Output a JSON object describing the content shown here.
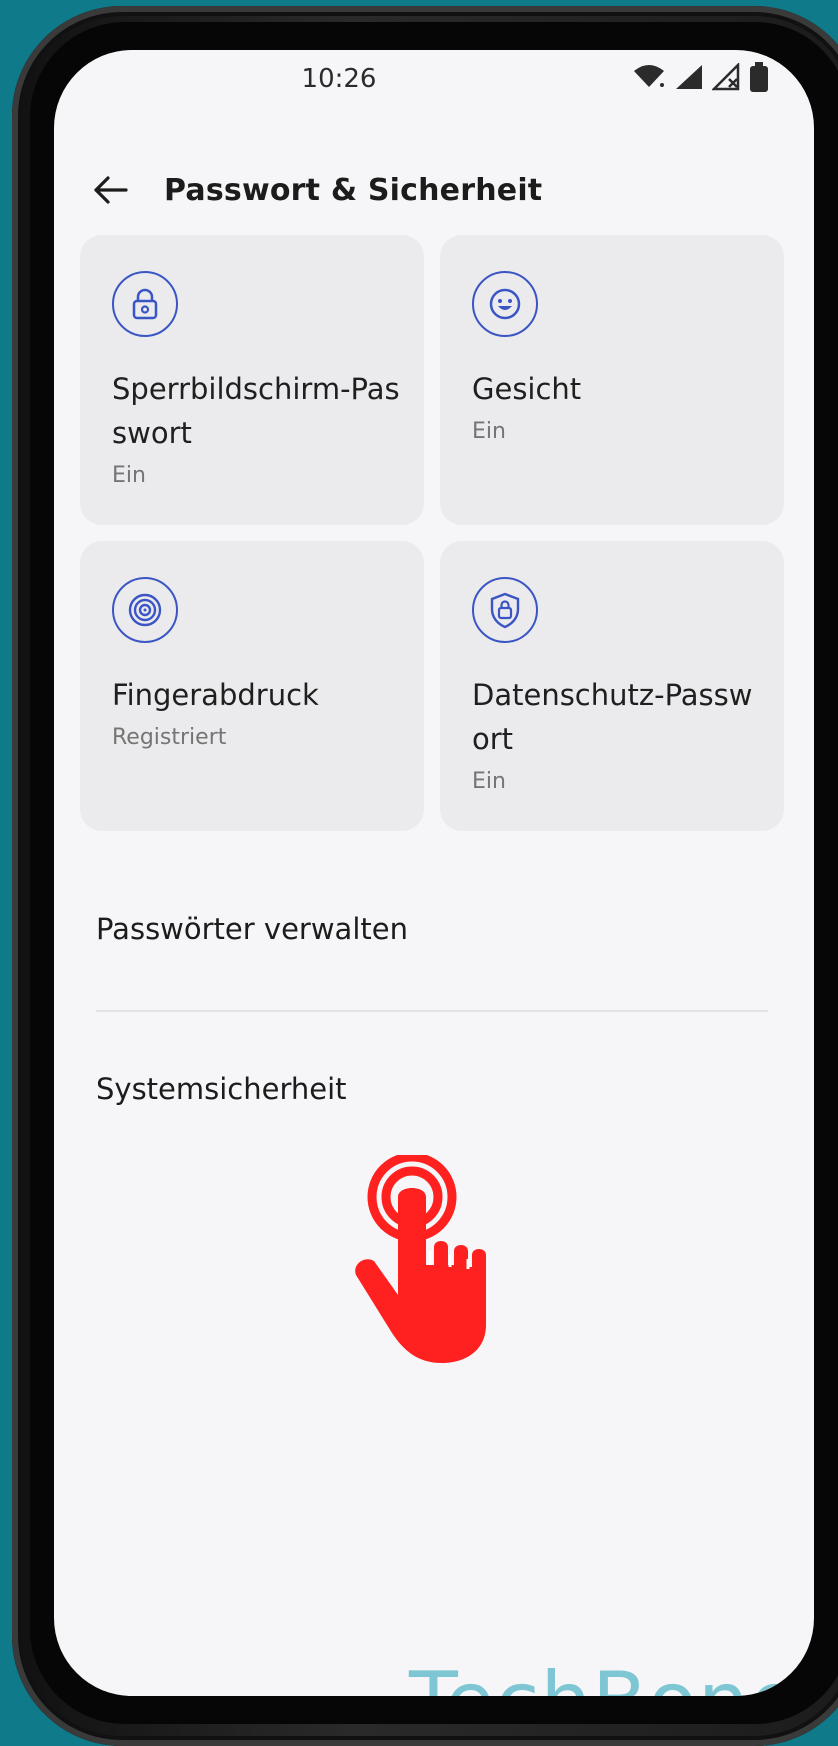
{
  "status_bar": {
    "time": "10:26"
  },
  "header": {
    "title": "Passwort & Sicherheit"
  },
  "cards": [
    {
      "title": "Sperrbildschirm-Pas swort",
      "subtitle": "Ein",
      "icon": "lock-icon"
    },
    {
      "title": "Gesicht",
      "subtitle": "Ein",
      "icon": "face-icon"
    },
    {
      "title": "Fingerabdruck",
      "subtitle": "Registriert",
      "icon": "fingerprint-icon"
    },
    {
      "title": "Datenschutz-Passw ort",
      "subtitle": "Ein",
      "icon": "shield-lock-icon"
    }
  ],
  "list": [
    {
      "label": "Passwörter verwalten"
    },
    {
      "label": "Systemsicherheit"
    }
  ],
  "watermark": "TechBone",
  "colors": {
    "accent": "#3b55c4",
    "tap_hand": "#ff2020",
    "background": "#0f7a8a"
  }
}
